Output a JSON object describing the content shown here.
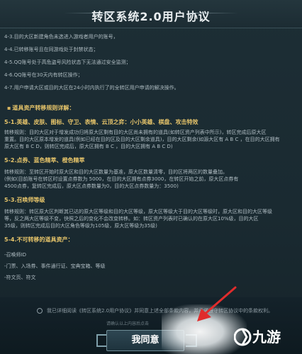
{
  "title": "转区系统2.0用户协议",
  "rules_top": [
    "4-3.目的大区新建角色未选进入游戏者用户的账号，",
    "4-4.已转移账号且在同游戏处于封禁状态；",
    "4-5.QQ账号处于高危盗号风险状态下无法通过安全监测；",
    "4-6.QQ账号在30天内有转区操作；",
    "4-7.用户申请大区或目的大区在24小时内执行了的全转区用户申请的解决操作。"
  ],
  "section_title": "道具资产转移规则详解：",
  "sections": [
    {
      "heading": "5-1.英雄、皮肤、图标、守卫、表情、云顶之弈：小小英雄、棋盘、攻击特效",
      "lines": [
        "转移规则：目的大区对于增发成功归将原大区剩有目的大区尚未拥有的道具(如转区资产列表中所示)，转区完成后原大区",
        "重置。目的大区原本增发的道具(例如已经在目的区及目的大区剩余道具)，目的大区剩余(如源大区有 A B C ，在目的大区拥有",
        "原大区有 B C D，则转区完成后，原大区拥有 B C ，目的大区拥有 A B C D)"
      ]
    },
    {
      "heading": "5-2.点券、蓝色精萃、橙色精萃",
      "lines": [
        "转移规则：至转区开始时原大区和目的大区数量为基准，原大区数量清零，目的区将两区的数量叠加。",
        "(例如(目前账号在转区时设置点券数为 5000，在目的大区拥有点券3000，在转区开始之前，原大区点券有",
        "4500点券，复转区完成后，原大区点券数量为0，目的大区点券数量为：3500)"
      ]
    },
    {
      "heading": "5-3.召唤师等级",
      "lines": [
        "转移规则：转区原大区判断其已达的原大区等级和目的大区等级，原大区等级大于目的大区等级时，原大区和目的大区等级",
        "等，反之两大区等级不变，快照之后的变化不会改变转移。如：转区资产列表时已确认的在原大区10%级，目的大区",
        "35级，则转区完成后目的大区角色等级为105级，原大区等级为35级)"
      ]
    },
    {
      "heading": "5-4.不可转移的道具资产：",
      "lines": [
        "-召唤师ID",
        "-门票、入场券、事件通行证、宝典宝箱、等级",
        "-符文页、符文"
      ]
    }
  ],
  "agree_text": "我已详细阅读《转区系统2.0用户协议》并同意上述全部条款内容，并承诺遵守转区协议中的条款权利。",
  "footer_note": "请确认以上内容后点击",
  "confirm_label": "我同意",
  "logo_text": "九游",
  "colors": {
    "accent_gold": "#e6c46a",
    "arrow_red": "#e02c2c",
    "button_bg": "#2e4652"
  }
}
